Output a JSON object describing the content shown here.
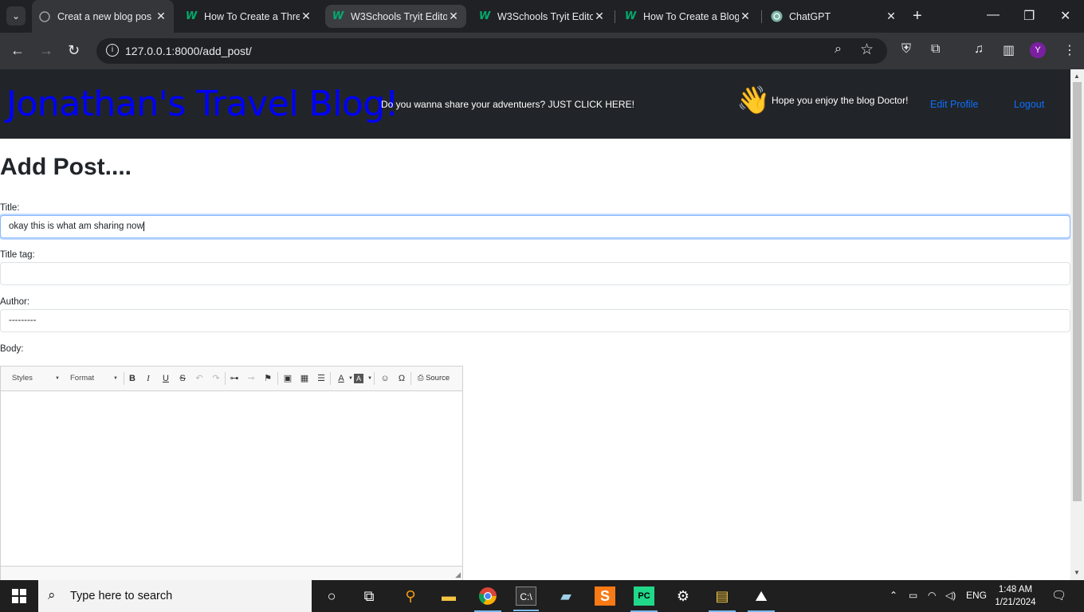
{
  "browser": {
    "tabs": [
      {
        "title": "Creat a new blog pos",
        "icon": "globe-icon",
        "active": true
      },
      {
        "title": "How To Create a Thre",
        "icon": "w3schools-icon"
      },
      {
        "title": "W3Schools Tryit Edito",
        "icon": "w3schools-icon",
        "highlighted": true
      },
      {
        "title": "W3Schools Tryit Edito",
        "icon": "w3schools-icon"
      },
      {
        "title": "How To Create a Blog",
        "icon": "w3schools-icon"
      },
      {
        "title": "ChatGPT",
        "icon": "chatgpt-icon"
      }
    ],
    "url": "127.0.0.1:8000/add_post/",
    "profile_initial": "Y"
  },
  "site": {
    "brand": "Jonathan's Travel Blog!",
    "share_link": "Do you wanna share your adventuers? JUST CLICK HERE!",
    "greeting_emoji": "👋",
    "greeting": "Hope you enjoy the blog Doctor!",
    "edit_profile": "Edit Profile",
    "logout": "Logout",
    "brand_color": "#0000ff",
    "link_color": "#0d6efd"
  },
  "form": {
    "heading": "Add Post....",
    "title_label": "Title:",
    "title_value": "okay this is what am sharing now",
    "title_tag_label": "Title tag:",
    "title_tag_value": "",
    "author_label": "Author:",
    "author_value": "---------",
    "body_label": "Body:",
    "editor": {
      "styles_label": "Styles",
      "format_label": "Format",
      "source_label": "Source"
    }
  },
  "taskbar": {
    "search_placeholder": "Type here to search",
    "language": "ENG",
    "time": "1:48 AM",
    "date": "1/21/2024"
  }
}
